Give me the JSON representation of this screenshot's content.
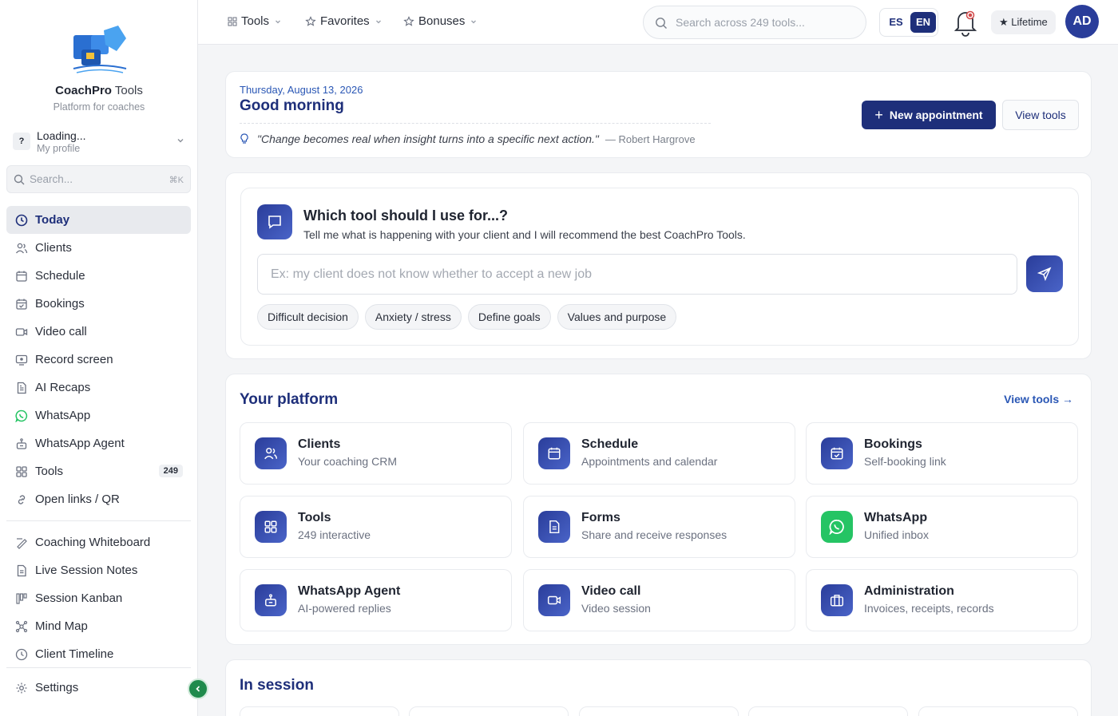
{
  "brand": {
    "name_bold": "CoachPro",
    "name_rest": " Tools",
    "subtitle": "Platform for coaches"
  },
  "profile": {
    "initial": "?",
    "name": "Loading...",
    "sub": "My profile"
  },
  "sidebar_search": {
    "placeholder": "Search...",
    "shortcut": "⌘K"
  },
  "nav": [
    {
      "label": "Today",
      "icon": "clock-icon",
      "active": true
    },
    {
      "label": "Clients",
      "icon": "users-icon"
    },
    {
      "label": "Schedule",
      "icon": "calendar-icon"
    },
    {
      "label": "Bookings",
      "icon": "calendar-check-icon"
    },
    {
      "label": "Video call",
      "icon": "video-icon"
    },
    {
      "label": "Record screen",
      "icon": "screen-record-icon"
    },
    {
      "label": "AI Recaps",
      "icon": "document-icon"
    },
    {
      "label": "WhatsApp",
      "icon": "whatsapp-icon"
    },
    {
      "label": "WhatsApp Agent",
      "icon": "bot-icon"
    },
    {
      "label": "Tools",
      "icon": "grid-icon",
      "count": "249"
    },
    {
      "label": "Open links / QR",
      "icon": "link-icon"
    }
  ],
  "nav2": [
    {
      "label": "Coaching Whiteboard",
      "icon": "whiteboard-icon"
    },
    {
      "label": "Live Session Notes",
      "icon": "notes-icon"
    },
    {
      "label": "Session Kanban",
      "icon": "kanban-icon"
    },
    {
      "label": "Mind Map",
      "icon": "mindmap-icon"
    },
    {
      "label": "Client Timeline",
      "icon": "timeline-icon"
    }
  ],
  "settings": {
    "label": "Settings"
  },
  "topbar": {
    "tools": "Tools",
    "favorites": "Favorites",
    "bonuses": "Bonuses",
    "search_placeholder": "Search across 249 tools...",
    "lang_es": "ES",
    "lang_en": "EN",
    "lifetime": "★ Lifetime",
    "user_initials": "AD"
  },
  "greeting": {
    "date": "Thursday, August 13, 2026",
    "title": "Good morning",
    "quote": "\"Change becomes real when insight turns into a specific next action.\"",
    "quote_author": "— Robert Hargrove",
    "new_appointment": "New appointment",
    "view_tools": "View tools"
  },
  "ask": {
    "title": "Which tool should I use for...?",
    "subtitle": "Tell me what is happening with your client and I will recommend the best CoachPro Tools.",
    "placeholder": "Ex: my client does not know whether to accept a new job",
    "chips": [
      "Difficult decision",
      "Anxiety / stress",
      "Define goals",
      "Values and purpose"
    ]
  },
  "platform": {
    "title": "Your platform",
    "view_tools": "View tools →",
    "tiles": [
      {
        "title": "Clients",
        "sub": "Your coaching CRM",
        "icon": "users-icon"
      },
      {
        "title": "Schedule",
        "sub": "Appointments and calendar",
        "icon": "calendar-icon"
      },
      {
        "title": "Bookings",
        "sub": "Self-booking link",
        "icon": "calendar-check-icon"
      },
      {
        "title": "Tools",
        "sub": "249 interactive",
        "icon": "grid-icon"
      },
      {
        "title": "Forms",
        "sub": "Share and receive responses",
        "icon": "form-icon"
      },
      {
        "title": "WhatsApp",
        "sub": "Unified inbox",
        "icon": "whatsapp-icon"
      },
      {
        "title": "WhatsApp Agent",
        "sub": "AI-powered replies",
        "icon": "bot-icon"
      },
      {
        "title": "Video call",
        "sub": "Video session",
        "icon": "video-icon"
      },
      {
        "title": "Administration",
        "sub": "Invoices, receipts, records",
        "icon": "briefcase-icon"
      }
    ]
  },
  "session": {
    "title": "In session"
  },
  "colors": {
    "primary": "#1e2f7a",
    "accent": "#2a57b5",
    "whatsapp": "#25c464",
    "collapse": "#1f8a4c"
  }
}
